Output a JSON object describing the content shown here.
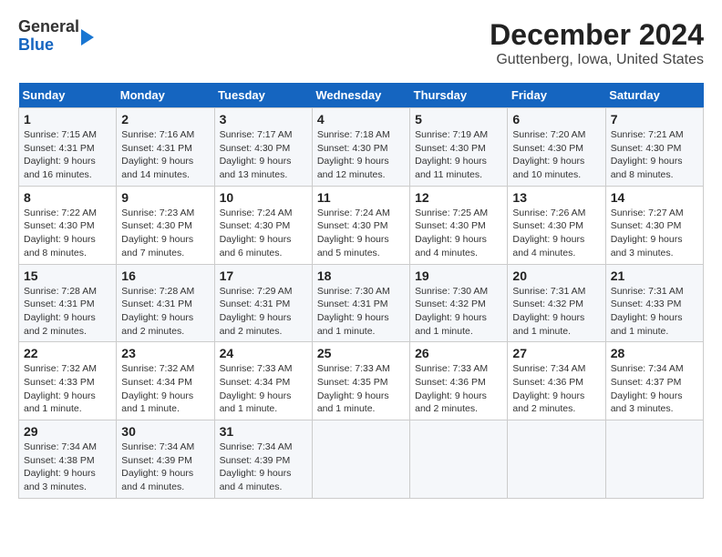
{
  "logo": {
    "general": "General",
    "blue": "Blue"
  },
  "title": "December 2024",
  "subtitle": "Guttenberg, Iowa, United States",
  "days_of_week": [
    "Sunday",
    "Monday",
    "Tuesday",
    "Wednesday",
    "Thursday",
    "Friday",
    "Saturday"
  ],
  "weeks": [
    [
      {
        "day": 1,
        "info": "Sunrise: 7:15 AM\nSunset: 4:31 PM\nDaylight: 9 hours\nand 16 minutes."
      },
      {
        "day": 2,
        "info": "Sunrise: 7:16 AM\nSunset: 4:31 PM\nDaylight: 9 hours\nand 14 minutes."
      },
      {
        "day": 3,
        "info": "Sunrise: 7:17 AM\nSunset: 4:30 PM\nDaylight: 9 hours\nand 13 minutes."
      },
      {
        "day": 4,
        "info": "Sunrise: 7:18 AM\nSunset: 4:30 PM\nDaylight: 9 hours\nand 12 minutes."
      },
      {
        "day": 5,
        "info": "Sunrise: 7:19 AM\nSunset: 4:30 PM\nDaylight: 9 hours\nand 11 minutes."
      },
      {
        "day": 6,
        "info": "Sunrise: 7:20 AM\nSunset: 4:30 PM\nDaylight: 9 hours\nand 10 minutes."
      },
      {
        "day": 7,
        "info": "Sunrise: 7:21 AM\nSunset: 4:30 PM\nDaylight: 9 hours\nand 8 minutes."
      }
    ],
    [
      {
        "day": 8,
        "info": "Sunrise: 7:22 AM\nSunset: 4:30 PM\nDaylight: 9 hours\nand 8 minutes."
      },
      {
        "day": 9,
        "info": "Sunrise: 7:23 AM\nSunset: 4:30 PM\nDaylight: 9 hours\nand 7 minutes."
      },
      {
        "day": 10,
        "info": "Sunrise: 7:24 AM\nSunset: 4:30 PM\nDaylight: 9 hours\nand 6 minutes."
      },
      {
        "day": 11,
        "info": "Sunrise: 7:24 AM\nSunset: 4:30 PM\nDaylight: 9 hours\nand 5 minutes."
      },
      {
        "day": 12,
        "info": "Sunrise: 7:25 AM\nSunset: 4:30 PM\nDaylight: 9 hours\nand 4 minutes."
      },
      {
        "day": 13,
        "info": "Sunrise: 7:26 AM\nSunset: 4:30 PM\nDaylight: 9 hours\nand 4 minutes."
      },
      {
        "day": 14,
        "info": "Sunrise: 7:27 AM\nSunset: 4:30 PM\nDaylight: 9 hours\nand 3 minutes."
      }
    ],
    [
      {
        "day": 15,
        "info": "Sunrise: 7:28 AM\nSunset: 4:31 PM\nDaylight: 9 hours\nand 2 minutes."
      },
      {
        "day": 16,
        "info": "Sunrise: 7:28 AM\nSunset: 4:31 PM\nDaylight: 9 hours\nand 2 minutes."
      },
      {
        "day": 17,
        "info": "Sunrise: 7:29 AM\nSunset: 4:31 PM\nDaylight: 9 hours\nand 2 minutes."
      },
      {
        "day": 18,
        "info": "Sunrise: 7:30 AM\nSunset: 4:31 PM\nDaylight: 9 hours\nand 1 minute."
      },
      {
        "day": 19,
        "info": "Sunrise: 7:30 AM\nSunset: 4:32 PM\nDaylight: 9 hours\nand 1 minute."
      },
      {
        "day": 20,
        "info": "Sunrise: 7:31 AM\nSunset: 4:32 PM\nDaylight: 9 hours\nand 1 minute."
      },
      {
        "day": 21,
        "info": "Sunrise: 7:31 AM\nSunset: 4:33 PM\nDaylight: 9 hours\nand 1 minute."
      }
    ],
    [
      {
        "day": 22,
        "info": "Sunrise: 7:32 AM\nSunset: 4:33 PM\nDaylight: 9 hours\nand 1 minute."
      },
      {
        "day": 23,
        "info": "Sunrise: 7:32 AM\nSunset: 4:34 PM\nDaylight: 9 hours\nand 1 minute."
      },
      {
        "day": 24,
        "info": "Sunrise: 7:33 AM\nSunset: 4:34 PM\nDaylight: 9 hours\nand 1 minute."
      },
      {
        "day": 25,
        "info": "Sunrise: 7:33 AM\nSunset: 4:35 PM\nDaylight: 9 hours\nand 1 minute."
      },
      {
        "day": 26,
        "info": "Sunrise: 7:33 AM\nSunset: 4:36 PM\nDaylight: 9 hours\nand 2 minutes."
      },
      {
        "day": 27,
        "info": "Sunrise: 7:34 AM\nSunset: 4:36 PM\nDaylight: 9 hours\nand 2 minutes."
      },
      {
        "day": 28,
        "info": "Sunrise: 7:34 AM\nSunset: 4:37 PM\nDaylight: 9 hours\nand 3 minutes."
      }
    ],
    [
      {
        "day": 29,
        "info": "Sunrise: 7:34 AM\nSunset: 4:38 PM\nDaylight: 9 hours\nand 3 minutes."
      },
      {
        "day": 30,
        "info": "Sunrise: 7:34 AM\nSunset: 4:39 PM\nDaylight: 9 hours\nand 4 minutes."
      },
      {
        "day": 31,
        "info": "Sunrise: 7:34 AM\nSunset: 4:39 PM\nDaylight: 9 hours\nand 4 minutes."
      },
      null,
      null,
      null,
      null
    ]
  ]
}
